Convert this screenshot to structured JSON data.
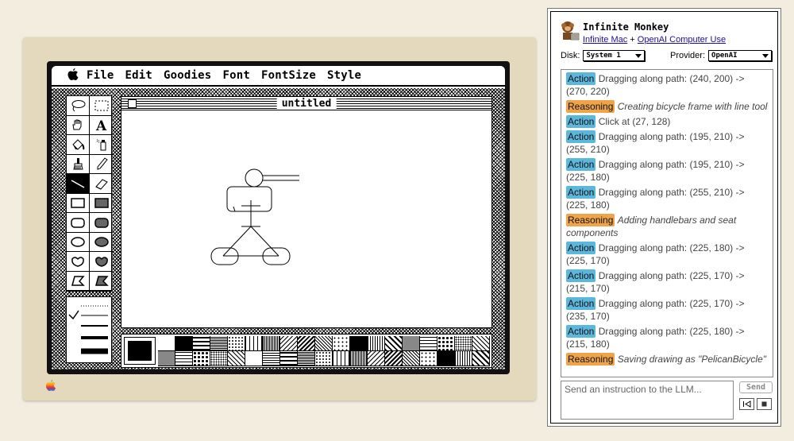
{
  "menubar": {
    "items": [
      "File",
      "Edit",
      "Goodies",
      "Font",
      "FontSize",
      "Style"
    ]
  },
  "window": {
    "title": "untitled"
  },
  "panel": {
    "title": "Infinite Monkey",
    "link1": "Infinite Mac",
    "plus": " + ",
    "link2": "OpenAI Computer Use",
    "disk_label": "Disk:",
    "disk_value": "System 1",
    "provider_label": "Provider:",
    "provider_value": "OpenAI",
    "log": [
      {
        "type": "Action",
        "text": "Dragging along path: (240, 200) -> (270, 220)"
      },
      {
        "type": "Reasoning",
        "text": "Creating bicycle frame with line tool"
      },
      {
        "type": "Action",
        "text": "Click at (27, 128)"
      },
      {
        "type": "Action",
        "text": "Dragging along path: (195, 210) -> (255, 210)"
      },
      {
        "type": "Action",
        "text": "Dragging along path: (195, 210) -> (225, 180)"
      },
      {
        "type": "Action",
        "text": "Dragging along path: (255, 210) -> (225, 180)"
      },
      {
        "type": "Reasoning",
        "text": "Adding handlebars and seat components"
      },
      {
        "type": "Action",
        "text": "Dragging along path: (225, 180) -> (225, 170)"
      },
      {
        "type": "Action",
        "text": "Dragging along path: (225, 170) -> (215, 170)"
      },
      {
        "type": "Action",
        "text": "Dragging along path: (225, 170) -> (235, 170)"
      },
      {
        "type": "Action",
        "text": "Dragging along path: (225, 180) -> (215, 180)"
      },
      {
        "type": "Reasoning",
        "text": "Saving drawing as \"PelicanBicycle\""
      }
    ],
    "input_placeholder": "Send an instruction to the LLM...",
    "send_label": "Send"
  },
  "colors": {
    "action": "#5bb8dc",
    "reasoning": "#f0a44a"
  }
}
